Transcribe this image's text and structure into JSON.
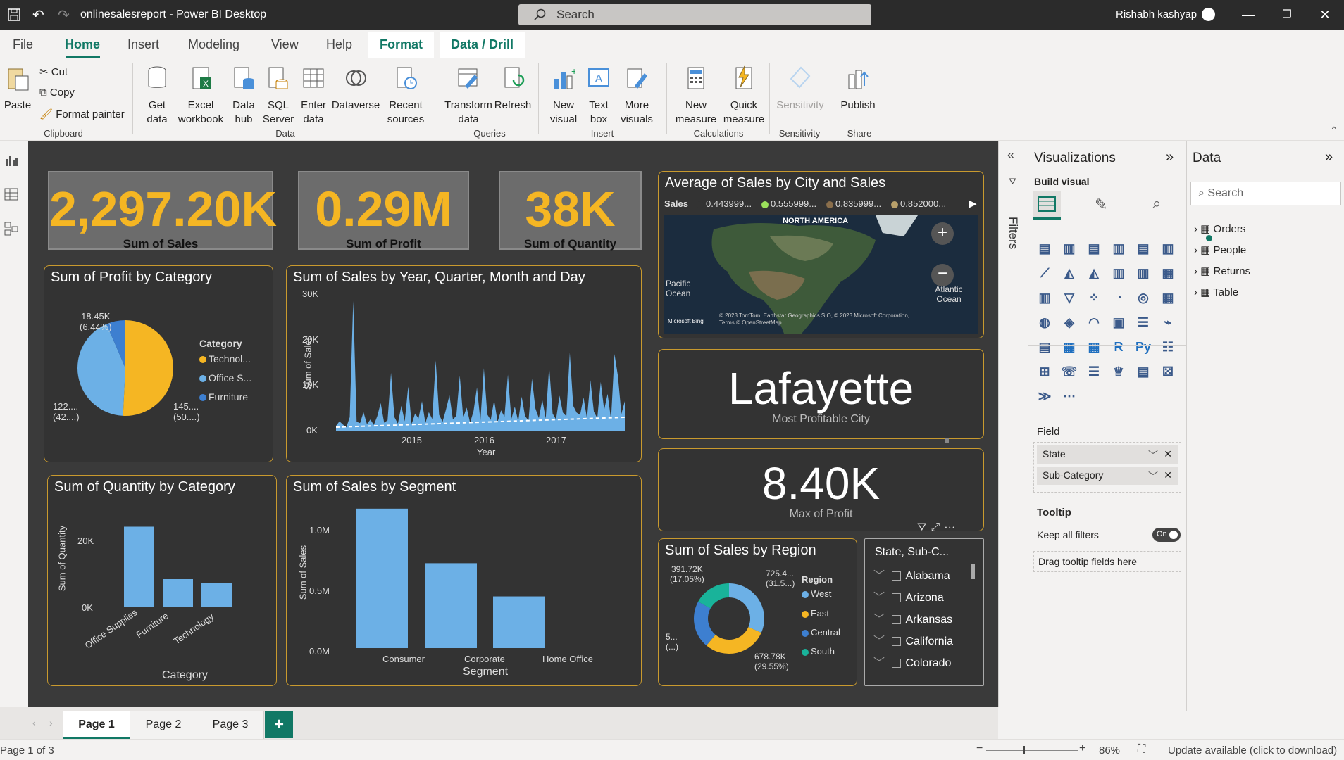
{
  "window": {
    "title": "onlinesalesreport - Power BI Desktop",
    "search_placeholder": "Search",
    "user": "Rishabh kashyap"
  },
  "menu": {
    "tabs": [
      "File",
      "Home",
      "Insert",
      "Modeling",
      "View",
      "Help"
    ],
    "context_tabs": [
      "Format",
      "Data / Drill"
    ]
  },
  "ribbon": {
    "clipboard": {
      "paste": "Paste",
      "cut": "Cut",
      "copy": "Copy",
      "format_painter": "Format painter",
      "group": "Clipboard"
    },
    "data": {
      "get_data": "Get data",
      "excel": "Excel workbook",
      "data_hub": "Data hub",
      "sql": "SQL Server",
      "enter": "Enter data",
      "dataverse": "Dataverse",
      "recent": "Recent sources",
      "group": "Data"
    },
    "queries": {
      "transform": "Transform data",
      "refresh": "Refresh",
      "group": "Queries"
    },
    "insert": {
      "new_visual": "New visual",
      "text_box": "Text box",
      "more_visuals": "More visuals",
      "group": "Insert"
    },
    "calculations": {
      "new_measure": "New measure",
      "quick_measure": "Quick measure",
      "group": "Calculations"
    },
    "sensitivity": {
      "label": "Sensitivity",
      "group": "Sensitivity"
    },
    "share": {
      "publish": "Publish",
      "group": "Share"
    }
  },
  "kpis": [
    {
      "value": "2,297.20K",
      "label": "Sum of Sales"
    },
    {
      "value": "0.29M",
      "label": "Sum of Profit"
    },
    {
      "value": "38K",
      "label": "Sum of Quantity"
    }
  ],
  "profit_by_category": {
    "title": "Sum of Profit by Category",
    "legend_title": "Category",
    "legend": [
      "Technol...",
      "Office S...",
      "Furniture"
    ],
    "labels": {
      "a": "18.45K",
      "a2": "(6.44%)",
      "b": "122....",
      "b2": "(42....)",
      "c": "145....",
      "c2": "(50....)"
    },
    "colors": [
      "#f5b623",
      "#6cb0e6",
      "#3d7fd0"
    ]
  },
  "sales_over_time": {
    "title": "Sum of Sales by Year, Quarter, Month and Day",
    "ylabel": "Sum of Sales",
    "xlabel": "Year",
    "yticks": [
      "30K",
      "20K",
      "10K",
      "0K"
    ],
    "xticks": [
      "2015",
      "2016",
      "2017"
    ]
  },
  "map": {
    "title": "Average of Sales by City and Sales",
    "legend_label": "Sales",
    "legend": [
      "0.443999...",
      "0.555999...",
      "0.835999...",
      "0.852000..."
    ],
    "legend_colors": [
      "#333333",
      "#9be05b",
      "#8a6e4b",
      "#b8a06a"
    ],
    "labels": {
      "na": "NORTH AMERICA",
      "pacific": "Pacific Ocean",
      "atlantic": "Atlantic Ocean",
      "credit": "© 2023 TomTom, Earthstar Geographics SIO, © 2023 Microsoft Corporation, Terms © OpenStreetMap",
      "bing": "Microsoft Bing"
    }
  },
  "city_card": {
    "value": "Lafayette",
    "label": "Most Profitable City"
  },
  "max_profit_card": {
    "value": "8.40K",
    "label": "Max of Profit"
  },
  "quantity_by_category": {
    "title": "Sum of Quantity by Category",
    "ylabel": "Sum of Quantity",
    "xlabel": "Category",
    "yticks": [
      "20K",
      "0K"
    ]
  },
  "sales_by_segment": {
    "title": "Sum of Sales by Segment",
    "ylabel": "Sum of Sales",
    "xlabel": "Segment",
    "yticks": [
      "1.0M",
      "0.5M",
      "0.0M"
    ]
  },
  "sales_by_region": {
    "title": "Sum of Sales by Region",
    "legend_title": "Region",
    "legend": [
      "West",
      "East",
      "Central",
      "South"
    ],
    "legend_colors": [
      "#6cb0e6",
      "#f5b623",
      "#3d7fd0",
      "#19b39a"
    ],
    "labels": {
      "a": "391.72K",
      "a2": "(17.05%)",
      "b": "725.4...",
      "b2": "(31.5...)",
      "c": "5...",
      "c2": "(...)",
      "d": "678.78K",
      "d2": "(29.55%)"
    }
  },
  "slicer": {
    "title": "State, Sub-C...",
    "items": [
      "Alabama",
      "Arizona",
      "Arkansas",
      "California",
      "Colorado"
    ]
  },
  "chart_data": [
    {
      "type": "pie",
      "title": "Sum of Profit by Category",
      "categories": [
        "Technology",
        "Office Supplies",
        "Furniture"
      ],
      "values": [
        145000,
        122000,
        18450
      ],
      "percent_labels": [
        "(50....)",
        "(42....)",
        "(6.44%)"
      ]
    },
    {
      "type": "bar",
      "title": "Sum of Quantity by Category",
      "categories": [
        "Office Supplies",
        "Furniture",
        "Technology"
      ],
      "values": [
        22900,
        8000,
        6900
      ],
      "ylim": [
        0,
        25000
      ]
    },
    {
      "type": "bar",
      "title": "Sum of Sales by Segment",
      "categories": [
        "Consumer",
        "Corporate",
        "Home Office"
      ],
      "values": [
        1160000,
        706000,
        430000
      ],
      "ylim": [
        0,
        1200000
      ]
    },
    {
      "type": "pie",
      "title": "Sum of Sales by Region",
      "categories": [
        "West",
        "East",
        "Central",
        "South"
      ],
      "values": [
        725400,
        678780,
        501240,
        391720
      ],
      "donut": true
    },
    {
      "type": "area",
      "title": "Sum of Sales by Year, Quarter, Month and Day",
      "xlabel": "Year",
      "ylabel": "Sum of Sales",
      "ylim": [
        0,
        30000
      ],
      "xticks": [
        "2015",
        "2016",
        "2017"
      ],
      "values": [
        1200,
        2200,
        1500,
        900,
        3100,
        28500,
        2100,
        1800,
        4200,
        1600,
        2600,
        1400,
        3300,
        6200,
        1900,
        2400,
        12800,
        3100,
        1700,
        5600,
        2200,
        9800,
        1600,
        3900,
        2800,
        6600,
        1800,
        4200,
        2700,
        15500,
        3600,
        2100,
        4800,
        7900,
        2600,
        3400,
        12200,
        3000,
        5200,
        1900,
        4400,
        9600,
        2300,
        13800,
        3700,
        2500,
        6800,
        2100,
        4600,
        3200,
        12400,
        2700,
        5400,
        2200,
        7600,
        3300,
        2400,
        11500,
        5000,
        2900,
        6900,
        2800,
        14200,
        3900,
        2600,
        7800,
        4100,
        3300,
        17200,
        5600,
        4100,
        3600,
        7400,
        2800,
        11200,
        4300,
        2900,
        10800,
        4700,
        8200,
        2600,
        16900,
        12100,
        3800,
        6600
      ]
    }
  ],
  "viz_pane": {
    "title": "Visualizations",
    "build": "Build visual",
    "field": "Field",
    "fields": [
      "State",
      "Sub-Category"
    ],
    "tooltip": "Tooltip",
    "keep_filters": "Keep all filters",
    "toggle": "On",
    "drag": "Drag tooltip fields here"
  },
  "data_pane": {
    "title": "Data",
    "search": "Search",
    "tables": [
      "Orders",
      "People",
      "Returns",
      "Table"
    ]
  },
  "filters_label": "Filters",
  "pages": [
    "Page 1",
    "Page 2",
    "Page 3"
  ],
  "status": {
    "page": "Page 1 of 3",
    "zoom": "86%",
    "update": "Update available (click to download)"
  }
}
